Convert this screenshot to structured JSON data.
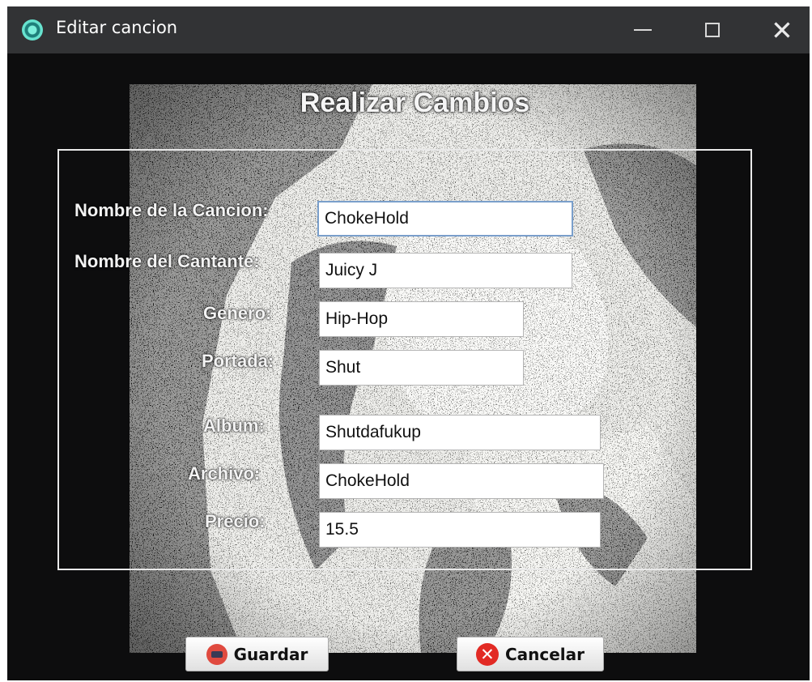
{
  "window": {
    "title": "Editar cancion"
  },
  "form": {
    "heading": "Realizar Cambios",
    "fields": [
      {
        "label": "Nombre de la Cancion:",
        "value": "ChokeHold"
      },
      {
        "label": "Nombre del Cantante:",
        "value": "Juicy J"
      },
      {
        "label": "Genero:",
        "value": "Hip-Hop"
      },
      {
        "label": "Portada:",
        "value": "Shut"
      },
      {
        "label": "Album:",
        "value": "Shutdafukup"
      },
      {
        "label": "Archivo:",
        "value": "ChokeHold"
      },
      {
        "label": "Precio:",
        "value": "15.5"
      }
    ]
  },
  "buttons": {
    "save": "Guardar",
    "cancel": "Cancelar"
  },
  "icons": {
    "app": "app-ring-icon",
    "minimize": "minimize-icon",
    "maximize": "maximize-icon",
    "close": "close-icon",
    "save": "save-icon",
    "cancel": "cancel-x-icon"
  },
  "colors": {
    "titlebar": "#323335",
    "background": "#0d0d0e",
    "field_focus": "#7a9fcb"
  }
}
